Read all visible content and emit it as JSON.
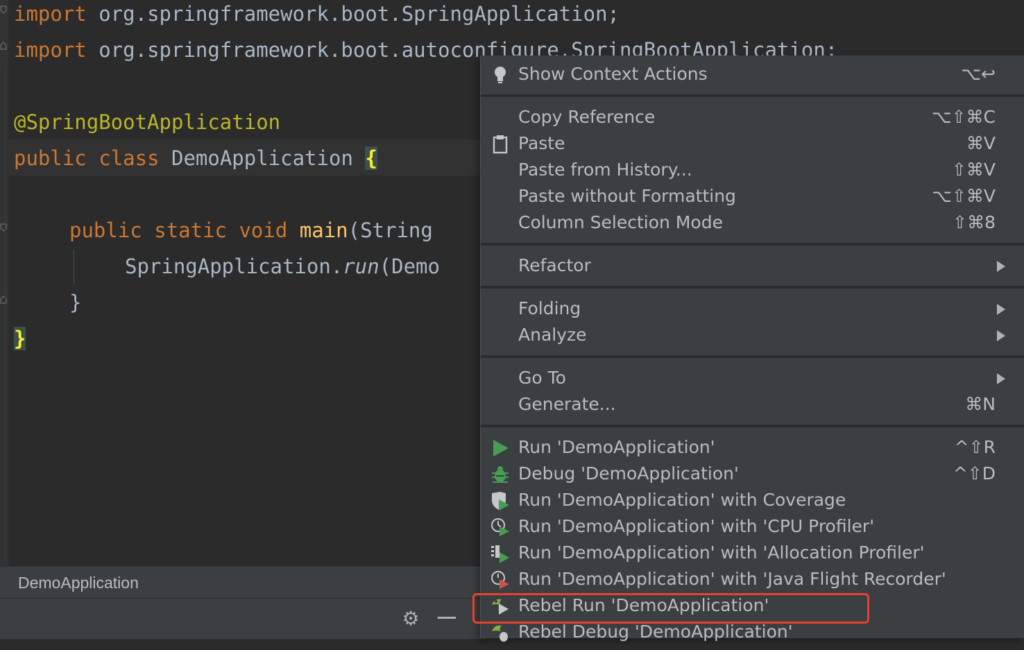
{
  "editor": {
    "line1": {
      "kw": "import",
      "rest": " org.springframework.boot.SpringApplication;"
    },
    "line2": {
      "kw": "import",
      "rest": " org.springframework.boot.autoconfigure.SpringBootApplication;"
    },
    "line4": {
      "ann": "@SpringBootApplication"
    },
    "line5": {
      "kw1": "public",
      "kw2": "class",
      "name": " DemoApplication ",
      "brace": "{"
    },
    "line7": {
      "kw1": "public",
      "kw2": "static",
      "kw3": "void",
      "fn": "main",
      "rest": "(String"
    },
    "line8": {
      "cls": "SpringApplication.",
      "call": "run",
      "rest": "(Demo"
    },
    "line9": {
      "text": "}"
    },
    "line10": {
      "brace": "}"
    }
  },
  "bottom_panel": {
    "title": "DemoApplication",
    "settings_icon": "gear-icon",
    "minimize_icon": "minimize-icon"
  },
  "context_menu": {
    "items": [
      {
        "label": "Show Context Actions",
        "shortcut": "⌥↩",
        "icon": "lightbulb-icon"
      },
      {
        "label": "Copy Reference",
        "shortcut": "⌥⇧⌘C"
      },
      {
        "label": "Paste",
        "shortcut": "⌘V",
        "icon": "clipboard-icon"
      },
      {
        "label": "Paste from History...",
        "shortcut": "⇧⌘V"
      },
      {
        "label": "Paste without Formatting",
        "shortcut": "⌥⇧⌘V"
      },
      {
        "label": "Column Selection Mode",
        "shortcut": "⇧⌘8"
      },
      {
        "label": "Refactor",
        "submenu": true
      },
      {
        "label": "Folding",
        "submenu": true
      },
      {
        "label": "Analyze",
        "submenu": true
      },
      {
        "label": "Go To",
        "submenu": true
      },
      {
        "label": "Generate...",
        "shortcut": "⌘N"
      },
      {
        "label": "Run 'DemoApplication'",
        "shortcut": "^⇧R",
        "icon": "run-icon"
      },
      {
        "label": "Debug 'DemoApplication'",
        "shortcut": "^⇧D",
        "icon": "debug-icon"
      },
      {
        "label": "Run 'DemoApplication' with Coverage",
        "icon": "coverage-icon"
      },
      {
        "label": "Run 'DemoApplication' with 'CPU Profiler'",
        "icon": "cpu-profiler-icon"
      },
      {
        "label": "Run 'DemoApplication' with 'Allocation Profiler'",
        "icon": "allocation-profiler-icon"
      },
      {
        "label": "Run 'DemoApplication' with 'Java Flight Recorder'",
        "icon": "flight-recorder-icon"
      },
      {
        "label": "Rebel Run 'DemoApplication'",
        "icon": "jrebel-run-icon"
      },
      {
        "label": "Rebel Debug 'DemoApplication'",
        "icon": "jrebel-debug-icon"
      }
    ]
  },
  "colors": {
    "editor_bg": "#2b2b2b",
    "menu_bg": "#3c3f41",
    "keyword": "#cc7832",
    "annotation": "#bbb529",
    "function": "#ffc66d",
    "text": "#a9b7c6",
    "run_green": "#499c54",
    "highlight_red": "#e8412f"
  }
}
